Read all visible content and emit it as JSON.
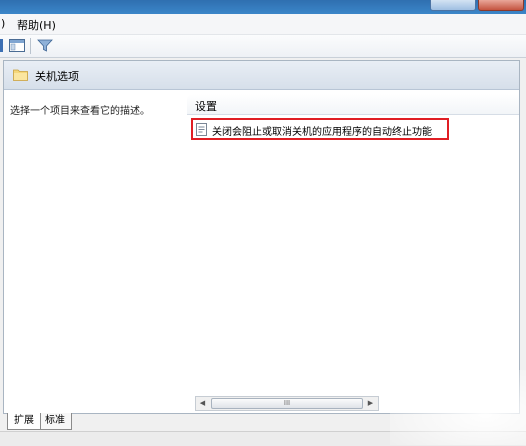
{
  "menubar": {
    "partial_item": ")",
    "help": "帮助(H)"
  },
  "toolbar": {
    "icons": [
      "view-toggle-icon",
      "filter-icon"
    ]
  },
  "pane": {
    "title": "关机选项",
    "description": "选择一个项目来查看它的描述。",
    "column_header": "设置",
    "items": [
      {
        "label": "关闭会阻止或取消关机的应用程序的自动终止功能",
        "highlighted": true
      }
    ],
    "scroll_thumb": "III"
  },
  "tabs": [
    {
      "label": "扩展",
      "active": true
    },
    {
      "label": "标准",
      "active": false
    }
  ],
  "colors": {
    "highlight_border": "#e01e24",
    "header_bg": "#dfe6ef"
  }
}
